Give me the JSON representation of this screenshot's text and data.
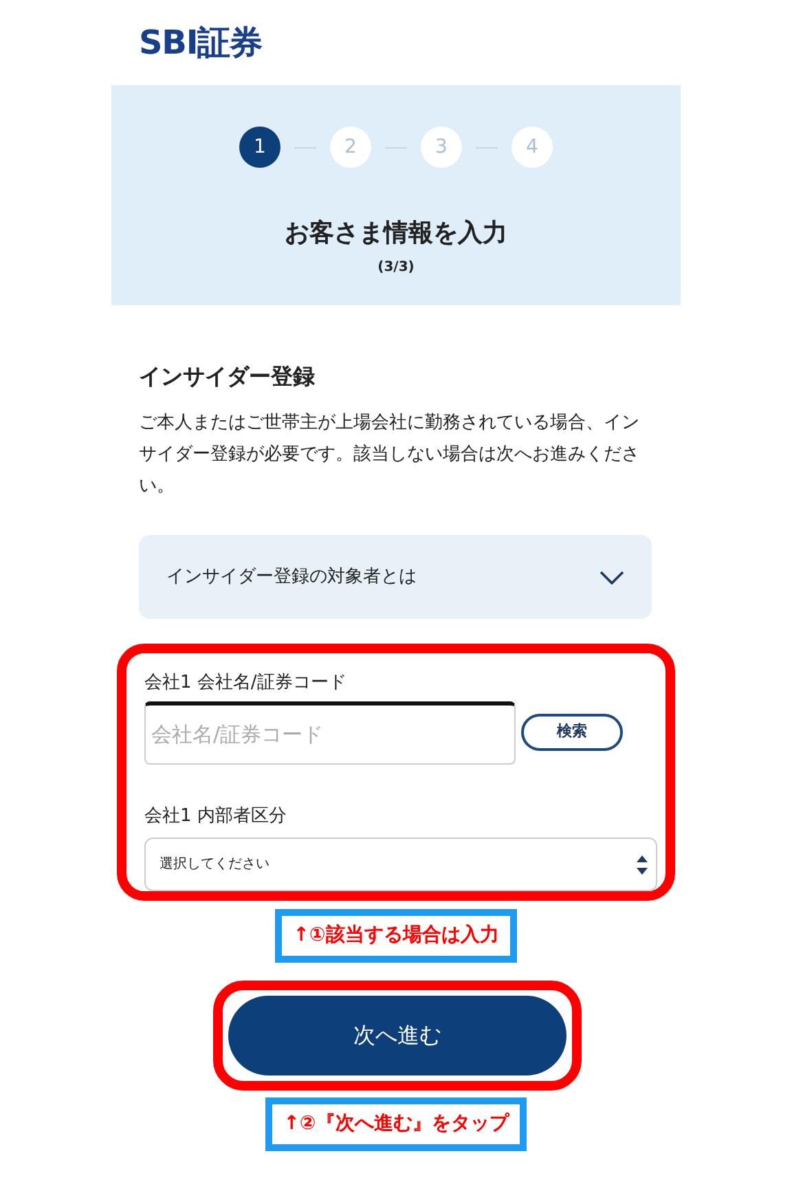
{
  "logo": {
    "text": "SBI証券"
  },
  "steps": [
    {
      "label": "1",
      "selected": true
    },
    {
      "label": "2",
      "selected": false
    },
    {
      "label": "3",
      "selected": false
    },
    {
      "label": "4",
      "selected": false
    }
  ],
  "banner": {
    "title": "お客さま情報を入力",
    "subtitle": "(3/3)"
  },
  "section": {
    "heading": "インサイダー登録",
    "description": "ご本人またはご世帯主が上場会社に勤務されている場合、インサイダー登録が必要です。該当しない場合は次へお進みください。",
    "accordion": {
      "label": "インサイダー登録の対象者とは",
      "expanded": false
    }
  },
  "form": {
    "company_label": "会社1 会社名/証券コード",
    "company_placeholder": "会社名/証券コード",
    "search_button": "検索",
    "category_label": "会社1 内部者区分",
    "category_select": "選択してください"
  },
  "annotations": [
    {
      "text": "↑①該当する場合は入力"
    },
    {
      "text": "↑②『次へ進む』をタップ"
    }
  ],
  "next_button": "次へ進む"
}
